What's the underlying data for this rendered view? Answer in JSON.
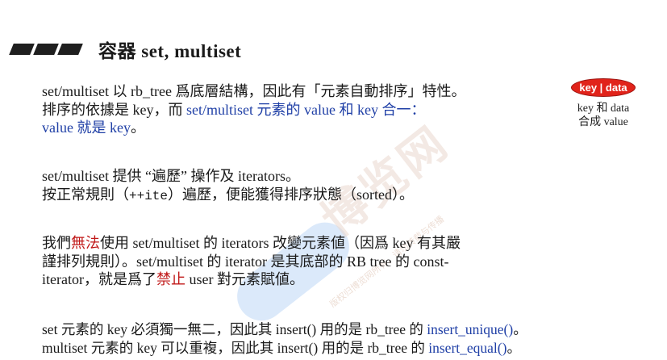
{
  "heading": {
    "title": "容器 set, multiset"
  },
  "paragraph1": {
    "l1": "set/multiset 以 rb_tree 爲底層結構，因此有「元素自動排序」特性。",
    "l2a": "排序的依據是 key，而 ",
    "l2b": "set/multiset 元素的 value 和 key 合一：",
    "l3": "value 就是 key",
    "l3end": "。"
  },
  "badge": {
    "label": "key | data",
    "note1": "key 和 data",
    "note2": "合成 value"
  },
  "paragraph2": {
    "l1": "set/multiset 提供 “遍歷” 操作及 iterators。",
    "l2a": "按正常規則（",
    "l2code": "++ite",
    "l2b": "）遍歷，便能獲得排序狀態（sorted）。"
  },
  "paragraph3": {
    "l1a": "我們",
    "l1red": "無法",
    "l1b": "使用 set/multiset 的 iterators 改變元素値（因爲 key 有其嚴",
    "l2": "謹排列規則）。set/multiset 的 iterator 是其底部的 RB tree 的 const-",
    "l3a": "iterator，就是爲了",
    "l3red": "禁止",
    "l3b": " user 對元素賦値。"
  },
  "paragraph4": {
    "l1a": "set 元素的 key 必須獨一無二，因此其 insert() 用的是 rb_tree 的 ",
    "l1fn": "insert_unique()",
    "l1b": "。",
    "l2a": "multiset 元素的 key 可以重複，因此其 insert() 用的是 rb_tree 的 ",
    "l2fn": "insert_equal()",
    "l2b": "。"
  },
  "watermark": {
    "brand": "博览网",
    "sub": "版权归博览网所有，请勿转载与传播"
  }
}
